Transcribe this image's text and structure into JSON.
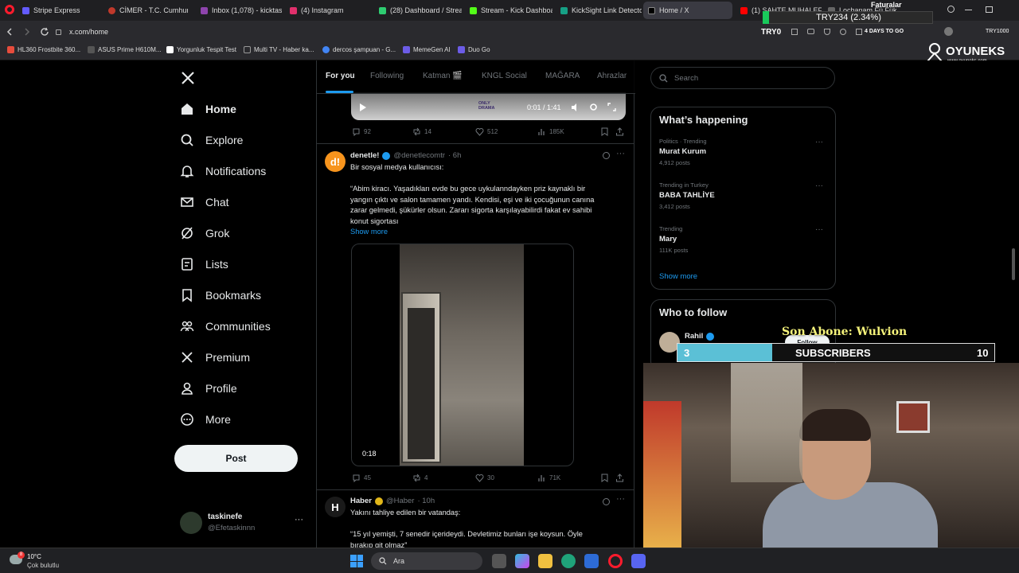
{
  "browser": {
    "tabs": [
      {
        "label": "Stripe Express",
        "color": "#635bff"
      },
      {
        "label": "CİMER - T.C. Cumhurbaşk",
        "color": "#c0392b"
      },
      {
        "label": "Inbox (1,078) - kicktaski",
        "color": "#8e44ad"
      },
      {
        "label": "(4) Instagram",
        "color": "#e1306c"
      },
      {
        "label": "(28) Dashboard / Stream",
        "color": "#2ecc71"
      },
      {
        "label": "Stream - Kick Dashboard",
        "color": "#53fc18"
      },
      {
        "label": "KickSight Link Detector",
        "color": "#16a085"
      },
      {
        "label": "Home / X",
        "color": "#000000"
      },
      {
        "label": "(1) SAHTE MUHALEFET",
        "color": "#ff0000"
      },
      {
        "label": "Lochanam Fü Fükürüsü",
        "color": "#444444"
      }
    ],
    "url": "x.com/home",
    "bookmarks": [
      {
        "label": "HL360 Frostbite 360...",
        "color": "#e74c3c"
      },
      {
        "label": "ASUS Prime H610M...",
        "color": "#555555"
      },
      {
        "label": "Yorgunluk Tespit Test",
        "color": "#ffffff"
      },
      {
        "label": "Multi TV - Haber ka...",
        "color": "#999999"
      },
      {
        "label": "dercos şampuan - G...",
        "color": "#4285f4"
      },
      {
        "label": "MemeGen AI",
        "color": "#6c5ce7"
      },
      {
        "label": "Duo Go",
        "color": "#6c5ce7"
      }
    ]
  },
  "overlay": {
    "ticker": "TRY234 (2.34%)",
    "faturalar": "Faturalar",
    "try0": "TRY0",
    "days": "4 DAYS TO GO",
    "tryright": "TRY1000",
    "brand": "OYUNEKS",
    "brand_sub": "www.oyuneks.com",
    "son_abone": "Son Abone: Wulvion",
    "subs_current": "3",
    "subs_label": "SUBSCRIBERS",
    "subs_goal": "10"
  },
  "sidebar": {
    "items": [
      {
        "label": "Home"
      },
      {
        "label": "Explore"
      },
      {
        "label": "Notifications"
      },
      {
        "label": "Chat"
      },
      {
        "label": "Grok"
      },
      {
        "label": "Lists"
      },
      {
        "label": "Bookmarks"
      },
      {
        "label": "Communities"
      },
      {
        "label": "Premium"
      },
      {
        "label": "Profile"
      },
      {
        "label": "More"
      }
    ],
    "post_label": "Post",
    "account": {
      "name": "taskinefe",
      "handle": "@Efetaskinnn"
    }
  },
  "feed": {
    "tabs": [
      "For you",
      "Following",
      "Katman 🎬",
      "KNGL Social",
      "MAĞARA",
      "Ahrazlar"
    ],
    "video1": {
      "time": "0:01 / 1:41",
      "watermark": "ONLY\nDRAMA"
    },
    "tweet0_actions": {
      "replies": "92",
      "reposts": "14",
      "likes": "512",
      "views": "185K"
    },
    "tweet1": {
      "name": "denetle!",
      "handle": "@denetlecomtr",
      "time": "· 6h",
      "intro": "Bir sosyal medya kullanıcısı:",
      "lines": [
        "“Abim kiracı. Yaşadıkları evde bu gece uykulanndayken priz kaynaklı bir",
        "yangın çıktı ve salon tamamen yandı. Kendisi, eşi ve iki çocuğunun canına",
        "zarar gelmedi, şükürler olsun. Zararı sigorta karşılayabilirdi fakat ev sahibi",
        "konut sigortası"
      ],
      "show_more": "Show more",
      "video_duration": "0:18",
      "actions": {
        "replies": "45",
        "reposts": "4",
        "likes": "30",
        "views": "71K"
      }
    },
    "tweet2": {
      "name": "Haber",
      "handle": "@Haber",
      "time": "· 10h",
      "intro": "Yakını tahliye edilen bir vatandaş:",
      "lines": [
        "“15 yıl yemişti, 7 senedir içerideydi. Devletimiz bunları işe koysun. Öyle",
        "bırakıp git olmaz”"
      ]
    }
  },
  "right": {
    "search_placeholder": "Search",
    "happening_title": "What’s happening",
    "trends": [
      {
        "category": "Politics · Trending",
        "title": "Murat Kurum",
        "count": "4,912 posts"
      },
      {
        "category": "Trending in Turkey",
        "title": "BABA TAHLİYE",
        "count": "3,412 posts"
      },
      {
        "category": "Trending",
        "title": "Mary",
        "count": "111K posts"
      }
    ],
    "show_more": "Show more",
    "follow_title": "Who to follow",
    "follow_name": "Rahil",
    "follow_btn": "Follow"
  },
  "taskbar": {
    "weather_temp": "10°C",
    "weather_desc": "Çok bulutlu",
    "search_placeholder": "Ara",
    "notif_count": "8"
  },
  "colors": {
    "accent": "#1d9bf0",
    "verified_gold": "#e2b719",
    "subs_bar": "#5bc0d6"
  }
}
